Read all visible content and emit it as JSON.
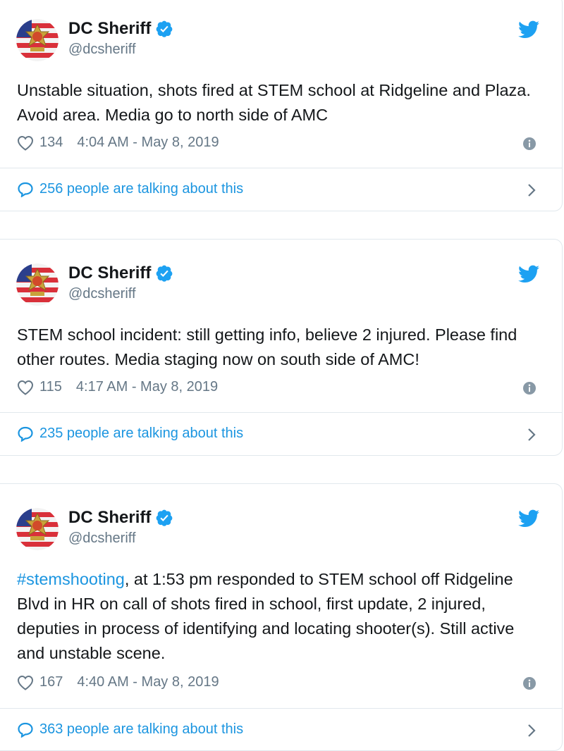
{
  "tweets": [
    {
      "name": "DC Sheriff",
      "handle": "@dcsheriff",
      "text": "Unstable situation, shots fired at STEM school at Ridgeline and Plaza. Avoid area. Media go to north side of AMC",
      "likes": "134",
      "timestamp": "4:04 AM - May 8, 2019",
      "talking": "256 people are talking about this"
    },
    {
      "name": "DC Sheriff",
      "handle": "@dcsheriff",
      "text": "STEM school incident: still getting info, believe 2 injured. Please find other routes. Media staging now on south side of AMC!",
      "likes": "115",
      "timestamp": "4:17 AM - May 8, 2019",
      "talking": "235 people are talking about this"
    },
    {
      "name": "DC Sheriff",
      "handle": "@dcsheriff",
      "hashtag": "#stemshooting",
      "text": ", at 1:53 pm responded to STEM school off Ridgeline Blvd in HR on call of shots fired in school, first update, 2 injured, deputies in process of identifying and locating shooter(s). Still active and unstable scene.",
      "likes": "167",
      "timestamp": "4:40 AM - May 8, 2019",
      "talking": "363 people are talking about this"
    }
  ],
  "icons": {
    "avatar": "sheriff-badge-avatar",
    "verified": "verified-badge-icon",
    "brand": "twitter-bird-icon",
    "like": "heart-icon",
    "info": "info-icon",
    "reply": "speech-bubble-icon",
    "more": "chevron-right-icon"
  },
  "colors": {
    "twitter_blue": "#1da1f2",
    "link_blue": "#1b95e0",
    "text": "#14171a",
    "muted": "#657786",
    "border": "#e1e8ed"
  }
}
